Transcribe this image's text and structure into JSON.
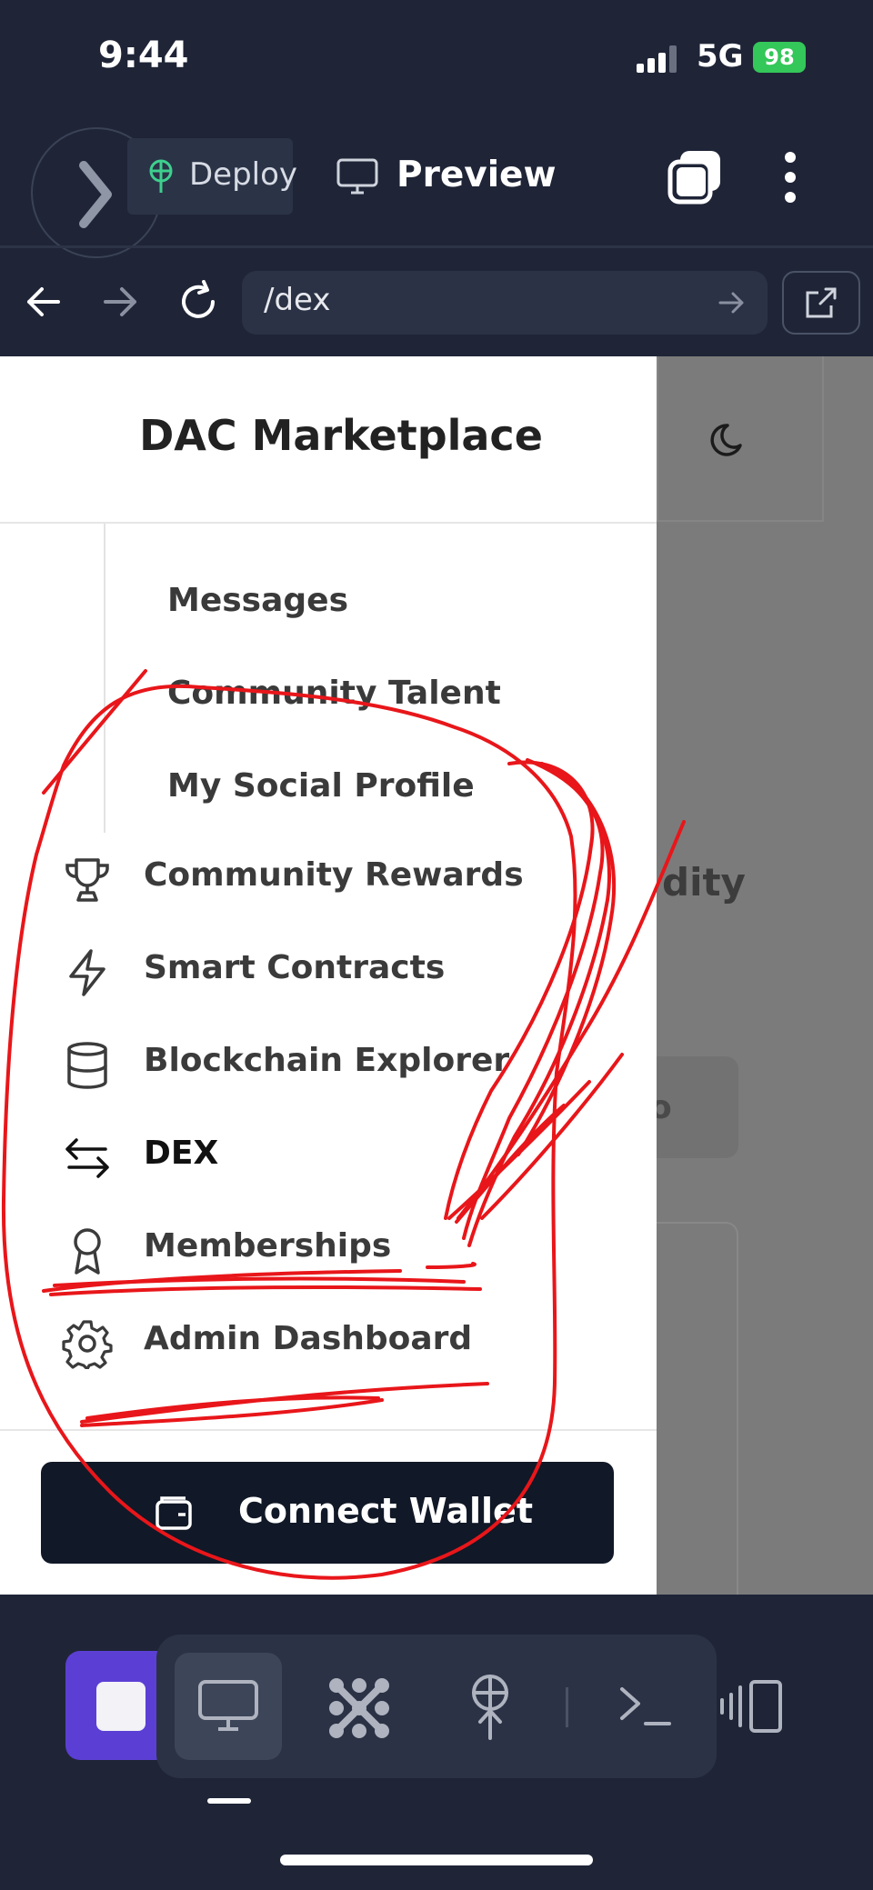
{
  "status_bar": {
    "time": "9:44",
    "network": "5G",
    "battery": "98"
  },
  "toolbar": {
    "deploy_label": "Deploy",
    "preview_label": "Preview"
  },
  "browser": {
    "url": "/dex"
  },
  "drawer": {
    "title": "DAC Marketplace",
    "sub_items": [
      {
        "label": "Messages"
      },
      {
        "label": "Community Talent"
      },
      {
        "label": "My Social Profile"
      }
    ],
    "items": [
      {
        "label": "Community Rewards",
        "icon": "trophy-icon"
      },
      {
        "label": "Smart Contracts",
        "icon": "lightning-icon"
      },
      {
        "label": "Blockchain Explorer",
        "icon": "database-icon"
      },
      {
        "label": "DEX",
        "icon": "swap-arrows-icon",
        "active": true
      },
      {
        "label": "Memberships",
        "icon": "award-icon"
      },
      {
        "label": "Admin Dashboard",
        "icon": "gear-icon"
      }
    ],
    "connect_label": "Connect Wallet"
  },
  "background_peek": {
    "text1": "dity",
    "text2": "o"
  },
  "colors": {
    "annotation": "#e8161a",
    "accent_stop": "#5b3fd4",
    "dark_bg": "#1f2537"
  }
}
